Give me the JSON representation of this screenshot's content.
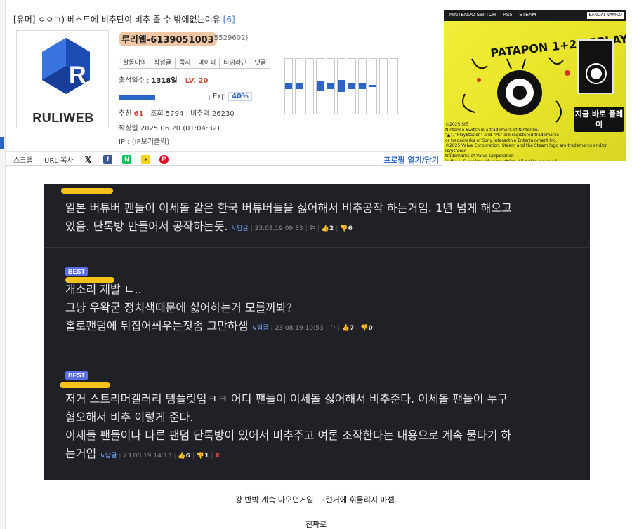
{
  "post": {
    "title": "[유머] ㅇㅇㄱ) 베스트에 비추단이 비추 줄 수 밖에없는이유",
    "comment_count": "[6]"
  },
  "logo": {
    "text": "RULIWEB"
  },
  "user": {
    "nickname": "루리웹-6139051003",
    "id": "(5529602)",
    "tabs": [
      "활동내역",
      "작성글",
      "쪽지",
      "마이피",
      "타임라인",
      "댓글"
    ],
    "attendance_label": "출석일수 :",
    "attendance_value": "1318일",
    "level": "LV. 20",
    "exp_label": "Exp.",
    "exp_percent": "40%",
    "exp_fraction": 0.4,
    "recommend_label": "추천",
    "recommend_value": "61",
    "views_label": "조회",
    "views_value": "5794",
    "downvote_label": "비추력",
    "downvote_value": "26230",
    "written_label": "작성일",
    "written_value": "2025.06.20 (01:04:32)",
    "ip_label": "IP :",
    "ip_value": "(IP보기클릭)"
  },
  "activity_levels": [
    0.3,
    0.3,
    0,
    0.45,
    0.3,
    0.55,
    0.3,
    0.3,
    0.1,
    0,
    0
  ],
  "actions": {
    "scrap": "스크랩",
    "url_copy": "URL 복사",
    "profile_toggle": "프로필 열기/닫기",
    "share_icons": [
      {
        "name": "x-share-icon",
        "glyph": "𝕏",
        "color": "#111111"
      },
      {
        "name": "facebook-share-icon",
        "glyph": "f",
        "color": "#3b5998"
      },
      {
        "name": "naver-share-icon",
        "glyph": "N",
        "color": "#03c75a"
      },
      {
        "name": "kakaotalk-share-icon",
        "glyph": "●",
        "color": "#f7d31b"
      },
      {
        "name": "pinterest-share-icon",
        "glyph": "P",
        "color": "#e60023"
      }
    ]
  },
  "ad": {
    "platforms": [
      "NINTENDO SWITCH",
      "PS5",
      "STEAM"
    ],
    "publisher": "BANDAI NAMCO",
    "game_title": "PATAPON 1+2 REPLAY",
    "cta": "지금 바로 플레이",
    "legal": "©2025 SIE\nNintendo Switch is a trademark of Nintendo.\n\"▲\", \"PlayStation\" and \"PS\" are registered trademarks\nor trademarks of Sony Interactive Entertainment Inc.\n©2025 Valve Corporation. Steam and the Steam logo are trademarks and/or registered\ntrademarks of Valve Corporation\nin the U.S. and/or other countries. All rights reserved.",
    "brand_color": "#efe931"
  },
  "comments": [
    {
      "best": "",
      "lines": [
        "일본 버튜버 팬들이 이세돌 같은 한국 버튜버들을 싫어해서 비추공작 하는거임. 1년 넘게 해오고",
        "있음. 단톡방 만들어서 공작하는듯."
      ],
      "reply": "↳답글",
      "date": "23.08.19 09:33",
      "up": "2",
      "down": "6",
      "report": ""
    },
    {
      "best": "BEST",
      "lines": [
        "개소리 제발 ㄴ..",
        "그냥 우왁굳 정치색때문에 싫어하는거 모를까봐?",
        "홀로팬덤에 뒤집어씌우는짓좀 그만하셈"
      ],
      "reply": "↳답글",
      "date": "23.08.19 10:53",
      "up": "7",
      "down": "0",
      "report": ""
    },
    {
      "best": "BEST",
      "lines": [
        "저거 스트리머갤러리 템플릿임ㅋㅋ 어디 팬들이 이세돌 싫어해서 비추준다. 이세돌 팬들이 누구",
        "혐오해서 비추 이렇게 준다.",
        "이세돌 팬들이나 다른 팬덤 단톡방이 있어서 비추주고 여론 조작한다는 내용으로 계속 물타기 하",
        "는거임"
      ],
      "reply": "↳답글",
      "date": "23.08.19 14:13",
      "up": "6",
      "down": "1",
      "report": "X"
    }
  ],
  "footer": {
    "line1": "걍 반박 계속 나오던거임. 그런거에 휘둘리지 마셈.",
    "line2": "진짜로"
  }
}
